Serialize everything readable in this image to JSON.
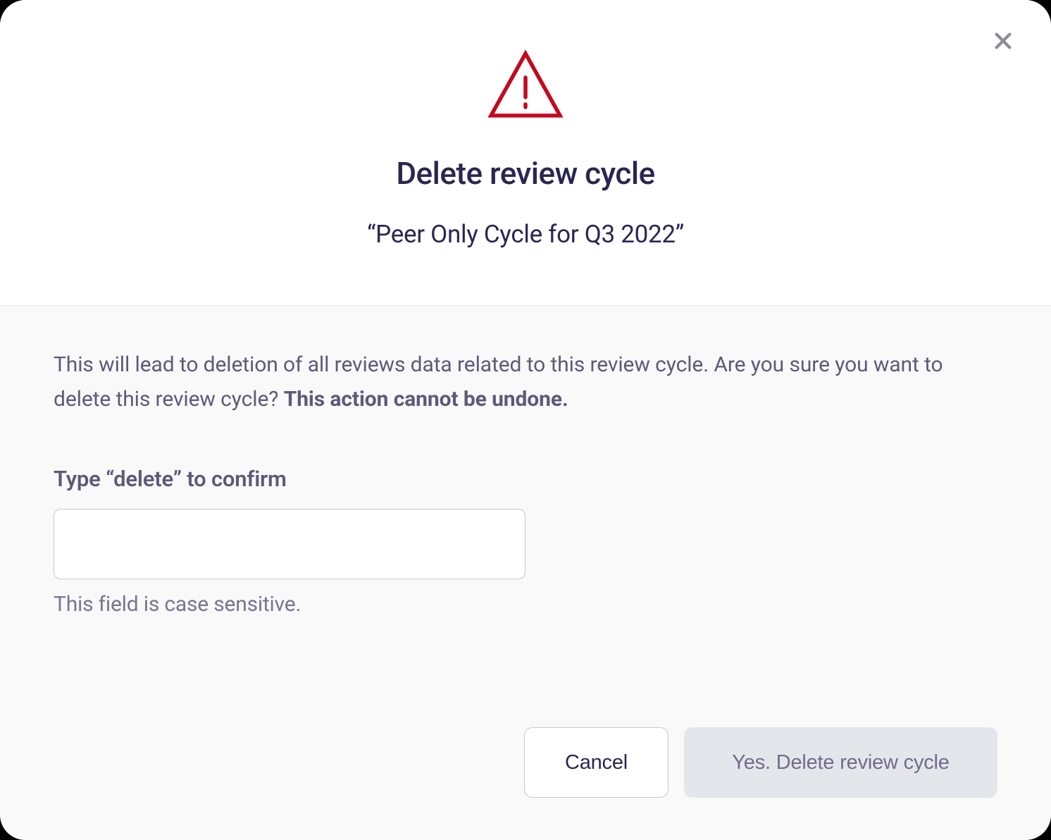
{
  "modal": {
    "title": "Delete review cycle",
    "subtitle": "“Peer Only Cycle for Q3 2022”",
    "warning_text_1": "This will lead to deletion of all reviews data related to this review cycle. Are you sure you want to delete this review cycle? ",
    "warning_text_bold": "This action cannot be undone.",
    "confirm_label": "Type “delete” to confirm",
    "confirm_input_value": "",
    "hint": "This field is case sensitive.",
    "cancel_label": "Cancel",
    "confirm_button_label": "Yes. Delete review cycle",
    "icon_color": "#c4091e",
    "close_icon_name": "close-icon",
    "warning_icon_name": "warning-triangle-icon"
  }
}
